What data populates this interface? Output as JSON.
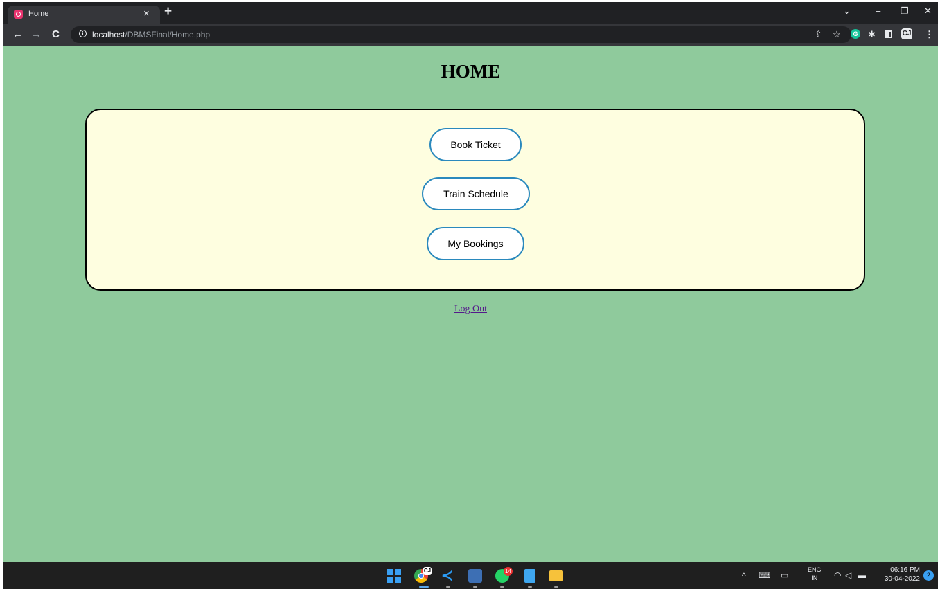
{
  "browser": {
    "tab_title": "Home",
    "tab_close": "×",
    "new_tab": "+",
    "url_host": "localhost",
    "url_path": "/DBMSFinal/Home.php",
    "icons": [
      "back-arrow-icon",
      "forward-arrow-icon",
      "reload-icon",
      "info-icon",
      "share-icon",
      "bookmark-star-icon",
      "grammarly-icon",
      "extensions-puzzle-icon",
      "side-panel-icon",
      "profile-extension-icon",
      "menu-kebab-icon"
    ]
  },
  "page": {
    "title": "HOME",
    "buttons": {
      "book_ticket": "Book Ticket",
      "train_schedule": "Train Schedule",
      "my_bookings": "My Bookings"
    },
    "logout": "Log Out",
    "colors": {
      "background": "#8fca9c",
      "panel": "#fefee0",
      "button_border": "#2a89bd",
      "link": "#551a8b"
    }
  },
  "taskbar": {
    "whatsapp_badge": "14",
    "lang_line1": "ENG",
    "lang_line2": "IN",
    "time": "06:16 PM",
    "date": "30-04-2022",
    "notification_count": "2"
  }
}
